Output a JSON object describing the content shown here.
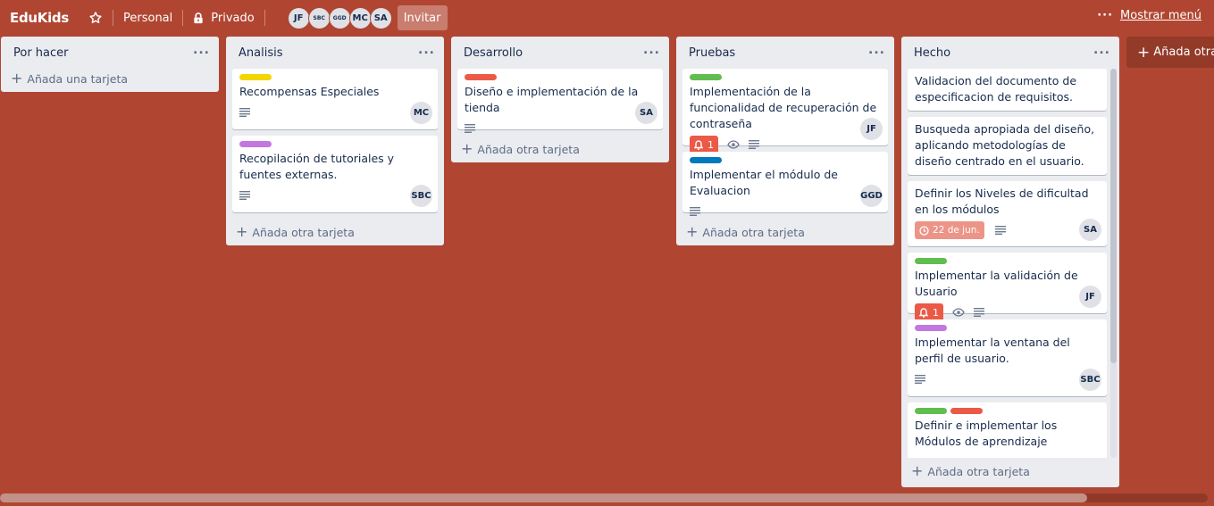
{
  "header": {
    "board_title": "EduKids",
    "workspace_label": "Personal",
    "visibility_label": "Privado",
    "members": [
      "JF",
      "SBC",
      "GGD",
      "MC",
      "SA"
    ],
    "invite_label": "Invitar",
    "show_menu_label": "Mostrar menú"
  },
  "colors": {
    "background": "#b04632",
    "list_bg": "#ebecf0",
    "label_yellow": "#f2d600",
    "label_red": "#eb5a46",
    "label_green": "#61bd4f",
    "label_blue": "#0079bf",
    "label_purple": "#c377e0"
  },
  "lists": [
    {
      "title": "Por hacer",
      "add_label": "Añada una tarjeta",
      "cards": []
    },
    {
      "title": "Analisis",
      "add_label": "Añada otra tarjeta",
      "cards": [
        {
          "title": "Recompensas Especiales",
          "labels": [
            "yellow"
          ],
          "avatar": "MC",
          "icons": [
            "description-icon"
          ]
        },
        {
          "title": "Recopilación de tutoriales y fuentes externas.",
          "labels": [
            "purple"
          ],
          "avatar": "SBC",
          "icons": [
            "description-icon"
          ]
        }
      ]
    },
    {
      "title": "Desarrollo",
      "add_label": "Añada otra tarjeta",
      "cards": [
        {
          "title": "Diseño e implementación de la tienda",
          "labels": [
            "red"
          ],
          "avatar": "SA",
          "icons": [
            "description-icon"
          ]
        }
      ]
    },
    {
      "title": "Pruebas",
      "add_label": "Añada otra tarjeta",
      "cards": [
        {
          "title": "Implementación de la funcionalidad de recuperación de contraseña",
          "labels": [
            "green"
          ],
          "avatar": "JF",
          "notification_count": "1",
          "icons": [
            "bell-icon",
            "eye-icon",
            "description-icon"
          ]
        },
        {
          "title": "Implementar el módulo de Evaluacion",
          "labels": [
            "blue"
          ],
          "avatar": "GGD",
          "icons": [
            "description-icon"
          ]
        }
      ]
    },
    {
      "title": "Hecho",
      "add_label": "Añada otra tarjeta",
      "cards": [
        {
          "title": "Validacion del documento de especificacion de requisitos.",
          "labels": []
        },
        {
          "title": "Busqueda apropiada del diseño, aplicando metodologías de diseño centrado en el usuario.",
          "labels": []
        },
        {
          "title": "Definir los Niveles de dificultad en los módulos",
          "labels": [],
          "due_date": "22 de jun.",
          "avatar": "SA",
          "icons": [
            "clock-icon",
            "description-icon"
          ]
        },
        {
          "title": "Implementar la validación de Usuario",
          "labels": [
            "green"
          ],
          "avatar": "JF",
          "notification_count": "1",
          "icons": [
            "bell-icon",
            "eye-icon",
            "description-icon"
          ]
        },
        {
          "title": "Implementar la ventana del perfil de usuario.",
          "labels": [
            "purple"
          ],
          "avatar": "SBC",
          "icons": [
            "description-icon"
          ]
        },
        {
          "title": "Definir e implementar los Módulos de aprendizaje",
          "labels": [
            "green",
            "red"
          ]
        }
      ]
    }
  ],
  "add_list_label": "Añada otra lista"
}
